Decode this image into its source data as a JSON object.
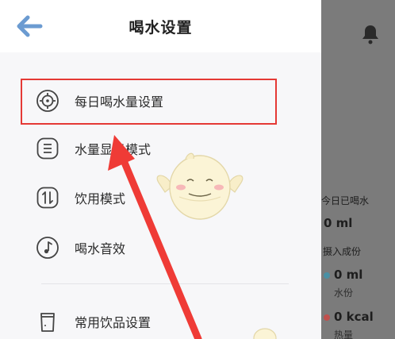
{
  "header": {
    "title": "喝水设置"
  },
  "menu": {
    "items": [
      {
        "label": "每日喝水量设置",
        "icon": "target-icon"
      },
      {
        "label": "水量显示模式",
        "icon": "list-icon"
      },
      {
        "label": "饮用模式",
        "icon": "swap-icon"
      },
      {
        "label": "喝水音效",
        "icon": "music-note-icon"
      },
      {
        "label": "常用饮品设置",
        "icon": "cup-icon"
      }
    ]
  },
  "background": {
    "today_label": "今日已喝水",
    "today_value": "0 ml",
    "intake_label": "摄入成份",
    "water_value": "0 ml",
    "water_label": "水份",
    "heat_value": "0 kcal",
    "heat_label": "热量"
  },
  "colors": {
    "accent": "#5a9bd5",
    "highlight": "#e53935",
    "water_dot": "#4a90a4",
    "heat_dot": "#c0504d"
  }
}
